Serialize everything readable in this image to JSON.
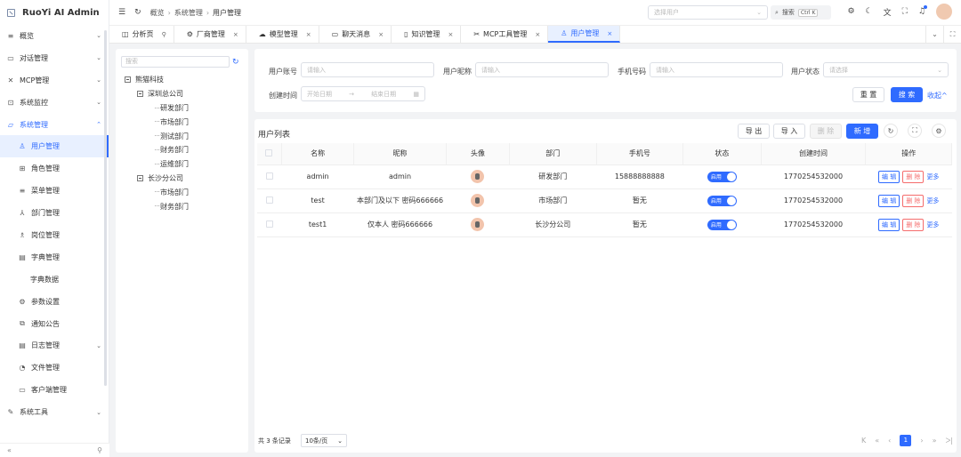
{
  "app": {
    "title": "RuoYi AI Admin"
  },
  "sidebar": {
    "items": [
      {
        "label": "概览",
        "icon": "≡",
        "arrow": "⌄"
      },
      {
        "label": "对话管理",
        "icon": "▭",
        "arrow": "⌄"
      },
      {
        "label": "MCP管理",
        "icon": "✕",
        "arrow": "⌄"
      },
      {
        "label": "系统监控",
        "icon": "⊡",
        "arrow": "⌄"
      },
      {
        "label": "系统管理",
        "icon": "▱",
        "arrow": "⌃"
      },
      {
        "label": "用户管理",
        "icon": "♙",
        "arrow": ""
      },
      {
        "label": "角色管理",
        "icon": "⊞",
        "arrow": ""
      },
      {
        "label": "菜单管理",
        "icon": "≡",
        "arrow": ""
      },
      {
        "label": "部门管理",
        "icon": "⅄",
        "arrow": ""
      },
      {
        "label": "岗位管理",
        "icon": "♗",
        "arrow": ""
      },
      {
        "label": "字典管理",
        "icon": "▤",
        "arrow": ""
      },
      {
        "label": "字典数据",
        "icon": "",
        "arrow": ""
      },
      {
        "label": "参数设置",
        "icon": "⚙",
        "arrow": ""
      },
      {
        "label": "通知公告",
        "icon": "⧉",
        "arrow": ""
      },
      {
        "label": "日志管理",
        "icon": "▤",
        "arrow": "⌄"
      },
      {
        "label": "文件管理",
        "icon": "◔",
        "arrow": ""
      },
      {
        "label": "客户端管理",
        "icon": "▭",
        "arrow": ""
      },
      {
        "label": "系统工具",
        "icon": "✎",
        "arrow": "⌄"
      }
    ],
    "collapse_icon": "«",
    "pin_icon": "⚲"
  },
  "header": {
    "breadcrumb": [
      "概览",
      "系统管理",
      "用户管理"
    ],
    "user_select_placeholder": "选择用户",
    "search_label": "搜索",
    "search_kbd": "Ctrl K"
  },
  "tabs": [
    {
      "label": "分析页",
      "icon": "◫",
      "close": "⚲"
    },
    {
      "label": "厂商管理",
      "icon": "⚙",
      "close": "×"
    },
    {
      "label": "模型管理",
      "icon": "☁",
      "close": "×"
    },
    {
      "label": "聊天消息",
      "icon": "▭",
      "close": "×"
    },
    {
      "label": "知识管理",
      "icon": "▯",
      "close": "×"
    },
    {
      "label": "MCP工具管理",
      "icon": "✂",
      "close": "×"
    },
    {
      "label": "用户管理",
      "icon": "♙",
      "close": "×"
    }
  ],
  "tree": {
    "search_placeholder": "搜索",
    "nodes": [
      {
        "label": "熊猫科技",
        "level": 0
      },
      {
        "label": "深圳总公司",
        "level": 1
      },
      {
        "label": "研发部门",
        "level": 2
      },
      {
        "label": "市场部门",
        "level": 2
      },
      {
        "label": "测试部门",
        "level": 2
      },
      {
        "label": "财务部门",
        "level": 2
      },
      {
        "label": "运维部门",
        "level": 2
      },
      {
        "label": "长沙分公司",
        "level": 1
      },
      {
        "label": "市场部门",
        "level": 2
      },
      {
        "label": "财务部门",
        "level": 2
      }
    ]
  },
  "query": {
    "account_label": "用户账号",
    "account_placeholder": "请输入",
    "nickname_label": "用户昵称",
    "nickname_placeholder": "请输入",
    "phone_label": "手机号码",
    "phone_placeholder": "请输入",
    "status_label": "用户状态",
    "status_placeholder": "请选择",
    "created_label": "创建时间",
    "start_placeholder": "开始日期",
    "end_placeholder": "结束日期",
    "date_sep": "→",
    "reset_label": "重 置",
    "search_label": "搜 索",
    "collapse_label": "收起"
  },
  "table": {
    "title": "用户列表",
    "export_label": "导 出",
    "import_label": "导 入",
    "delete_label": "删 除",
    "add_label": "新 增",
    "columns": [
      "名称",
      "昵称",
      "头像",
      "部门",
      "手机号",
      "状态",
      "创建时间",
      "操作"
    ],
    "rows": [
      {
        "name": "admin",
        "nickname": "admin",
        "dept": "研发部门",
        "phone": "15888888888",
        "status": "启用",
        "created": "1770254532000"
      },
      {
        "name": "test",
        "nickname": "本部门及以下 密码666666",
        "dept": "市场部门",
        "phone": "暂无",
        "status": "启用",
        "created": "1770254532000"
      },
      {
        "name": "test1",
        "nickname": "仅本人 密码666666",
        "dept": "长沙分公司",
        "phone": "暂无",
        "status": "启用",
        "created": "1770254532000"
      }
    ],
    "edit_label": "编 辑",
    "del_label": "删 除",
    "more_label": "更多"
  },
  "pager": {
    "total": "共 3 条记录",
    "page_size": "10条/页",
    "current": "1"
  },
  "colors": {
    "primary": "#2f6bff",
    "danger": "#f56c6c"
  }
}
